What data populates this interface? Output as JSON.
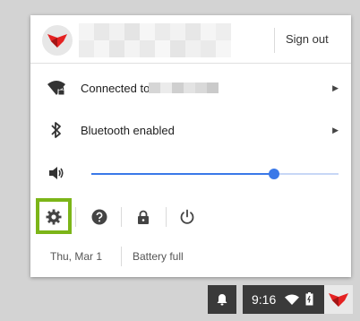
{
  "header": {
    "sign_out_label": "Sign out"
  },
  "network": {
    "label": "Connected to"
  },
  "bluetooth": {
    "label": "Bluetooth enabled"
  },
  "volume": {
    "level": 0.74
  },
  "footer": {
    "date": "Thu, Mar 1",
    "battery": "Battery full"
  },
  "tray": {
    "time": "9:16"
  },
  "colors": {
    "accent": "#3a78e8",
    "highlight": "#7cb518",
    "brand": "#e52222"
  }
}
